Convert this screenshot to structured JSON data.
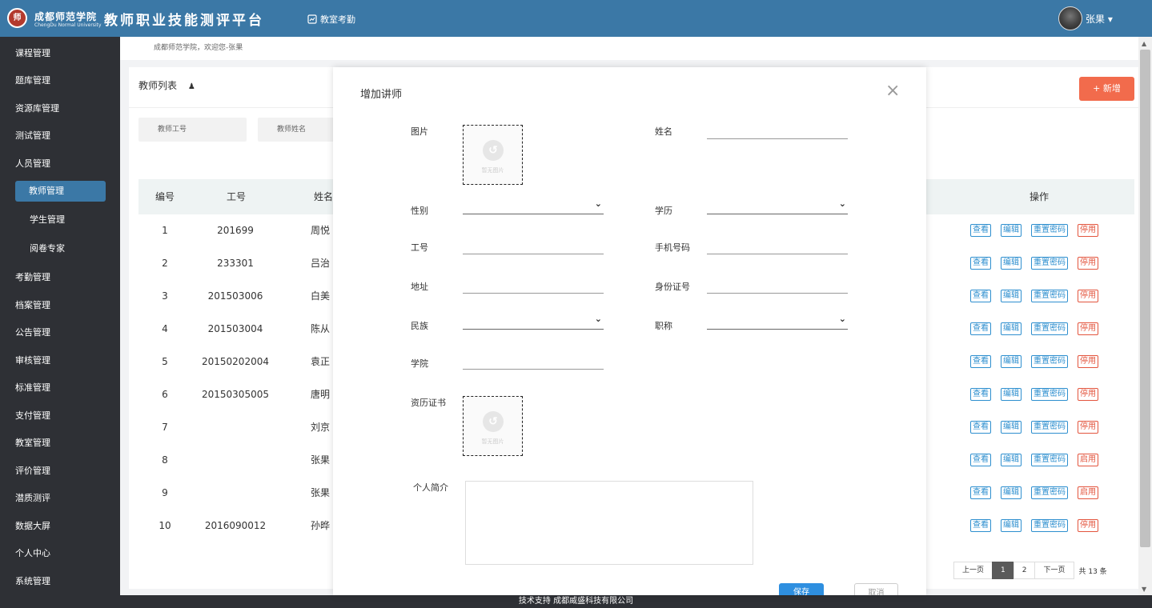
{
  "header": {
    "logo_mark": "师",
    "university_cn": "成都师范学院",
    "university_en": "ChengDu Normal University",
    "platform_title": "教师职业技能测评平台",
    "nav_link": "教室考勤",
    "user_name": "张果 ▾"
  },
  "sidebar": {
    "items": [
      "课程管理",
      "题库管理",
      "资源库管理",
      "测试管理",
      "人员管理",
      "教师管理",
      "学生管理",
      "阅卷专家",
      "考勤管理",
      "档案管理",
      "公告管理",
      "审核管理",
      "标准管理",
      "支付管理",
      "教室管理",
      "评价管理",
      "潜质测评",
      "数据大屏",
      "个人中心",
      "系统管理"
    ]
  },
  "breadcrumb": "成都师范学院，欢迎您-张果",
  "panel": {
    "title": "教师列表",
    "add_label": "+  新增",
    "filters": [
      "教师工号",
      "教师姓名"
    ]
  },
  "table": {
    "headers": [
      "编号",
      "工号",
      "姓名",
      "操作"
    ],
    "rows": [
      {
        "idx": "1",
        "no": "201699",
        "name": "周悦",
        "status_op": "停用"
      },
      {
        "idx": "2",
        "no": "233301",
        "name": "吕治",
        "status_op": "停用"
      },
      {
        "idx": "3",
        "no": "201503006",
        "name": "白美",
        "status_op": "停用"
      },
      {
        "idx": "4",
        "no": "201503004",
        "name": "陈从",
        "status_op": "停用"
      },
      {
        "idx": "5",
        "no": "20150202004",
        "name": "袁正",
        "status_op": "停用"
      },
      {
        "idx": "6",
        "no": "20150305005",
        "name": "唐明",
        "status_op": "停用"
      },
      {
        "idx": "7",
        "no": "",
        "name": "刘京",
        "status_op": "停用"
      },
      {
        "idx": "8",
        "no": "",
        "name": "张果",
        "status_op": "启用"
      },
      {
        "idx": "9",
        "no": "",
        "name": "张果",
        "status_op": "启用"
      },
      {
        "idx": "10",
        "no": "2016090012",
        "name": "孙晔",
        "status_op": "停用"
      }
    ],
    "ops": {
      "view": "查看",
      "edit": "编辑",
      "reset": "重置密码"
    }
  },
  "pager": {
    "prev": "上一页",
    "pages": [
      "1",
      "2"
    ],
    "current": "1",
    "next": "下一页",
    "total": "共 13 条"
  },
  "modal": {
    "title": "增加讲师",
    "close": "×",
    "upload_hint": "暂无图片",
    "labels": {
      "photo": "图片",
      "name": "姓名",
      "gender": "性别",
      "education": "学历",
      "job_no": "工号",
      "phone": "手机号码",
      "address": "地址",
      "id_card": "身份证号",
      "ethnicity": "民族",
      "title": "职称",
      "college": "学院",
      "certificate": "资历证书",
      "bio": "个人简介"
    },
    "save": "保存",
    "cancel": "取消"
  },
  "footer": "技术支持 成都威盛科技有限公司"
}
